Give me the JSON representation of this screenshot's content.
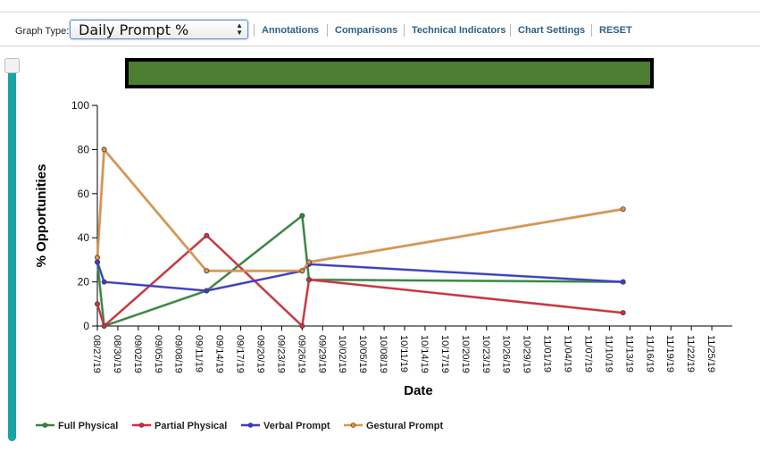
{
  "toolbar": {
    "graph_type_label": "Graph Type:",
    "graph_type_value": "Daily Prompt %",
    "links": [
      "Annotations",
      "Comparisons",
      "Technical Indicators",
      "Chart Settings",
      "RESET"
    ]
  },
  "colors": {
    "banner": "#4e7e32",
    "scrollbar": "#1aa3a3",
    "link": "#2d5f86"
  },
  "chart_data": {
    "type": "line",
    "xlabel": "Date",
    "ylabel": "% Opportunities",
    "ylim": [
      0,
      100
    ],
    "yticks": [
      "0",
      "20",
      "40",
      "60",
      "80",
      "100"
    ],
    "xlim": [
      "08/27/19",
      "11/28/19"
    ],
    "xticks": [
      "08/27/19",
      "08/30/19",
      "09/02/19",
      "09/05/19",
      "09/08/19",
      "09/11/19",
      "09/14/19",
      "09/17/19",
      "09/20/19",
      "09/23/19",
      "09/26/19",
      "09/29/19",
      "10/02/19",
      "10/05/19",
      "10/08/19",
      "10/11/19",
      "10/14/19",
      "10/17/19",
      "10/20/19",
      "10/23/19",
      "10/26/19",
      "10/29/19",
      "11/01/19",
      "11/04/19",
      "11/07/19",
      "11/10/19",
      "11/13/19",
      "11/16/19",
      "11/19/19",
      "11/22/19",
      "11/25/19"
    ],
    "legend_position": "bottom",
    "grid": false,
    "series": [
      {
        "name": "Full Physical",
        "color": "#2e8b3a",
        "points": [
          [
            "08/27/19",
            29
          ],
          [
            "08/28/19",
            0
          ],
          [
            "09/12/19",
            16
          ],
          [
            "09/26/19",
            50
          ],
          [
            "09/27/19",
            21
          ],
          [
            "11/12/19",
            20
          ]
        ]
      },
      {
        "name": "Partial Physical",
        "color": "#d92b3a",
        "points": [
          [
            "08/27/19",
            10
          ],
          [
            "08/28/19",
            0
          ],
          [
            "09/12/19",
            41
          ],
          [
            "09/26/19",
            0
          ],
          [
            "09/27/19",
            21
          ],
          [
            "11/12/19",
            6
          ]
        ]
      },
      {
        "name": "Verbal Prompt",
        "color": "#3a3ad0",
        "points": [
          [
            "08/27/19",
            29
          ],
          [
            "08/28/19",
            20
          ],
          [
            "09/12/19",
            16
          ],
          [
            "09/26/19",
            25
          ],
          [
            "09/27/19",
            28
          ],
          [
            "11/12/19",
            20
          ]
        ]
      },
      {
        "name": "Gestural Prompt",
        "color": "#e8913a",
        "points": [
          [
            "08/27/19",
            31
          ],
          [
            "08/28/19",
            80
          ],
          [
            "09/12/19",
            25
          ],
          [
            "09/26/19",
            25
          ],
          [
            "09/27/19",
            29
          ],
          [
            "11/12/19",
            53
          ]
        ]
      }
    ]
  }
}
